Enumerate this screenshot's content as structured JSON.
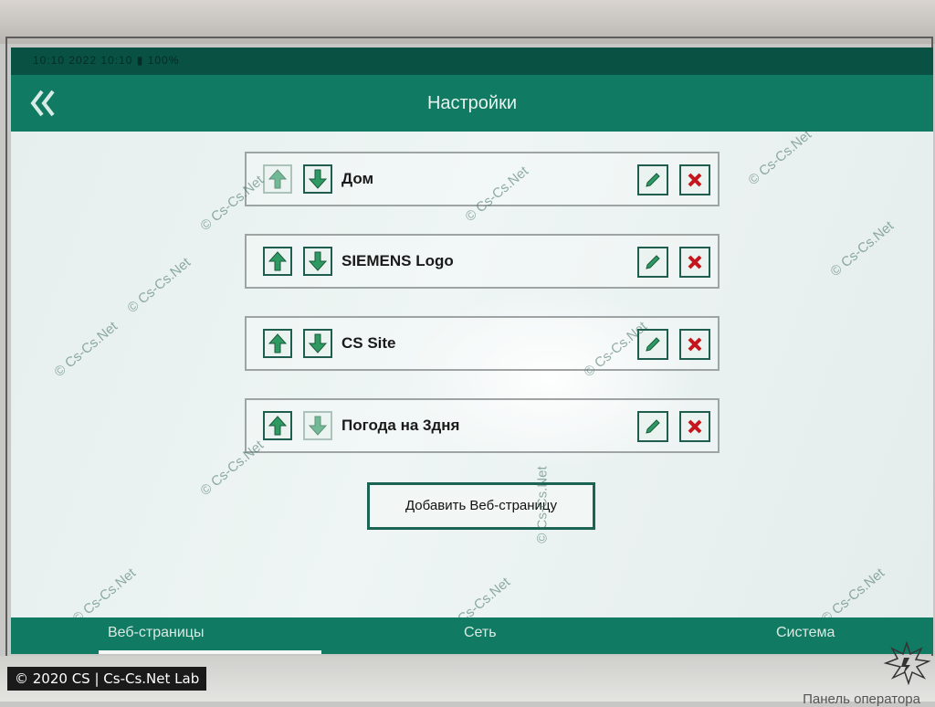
{
  "status": {
    "text": "10:10 2022 10:10 ▮ 100%"
  },
  "header": {
    "title": "Настройки",
    "back_icon": "double-chevron-left-icon"
  },
  "pages": [
    {
      "label": "Дом",
      "up_enabled": false,
      "down_enabled": true
    },
    {
      "label": "SIEMENS Logo",
      "up_enabled": true,
      "down_enabled": true
    },
    {
      "label": "CS Site",
      "up_enabled": true,
      "down_enabled": true
    },
    {
      "label": "Погода на 3дня",
      "up_enabled": true,
      "down_enabled": false
    }
  ],
  "add_button": {
    "label": "Добавить Веб-страницу"
  },
  "tabs": [
    {
      "label": "Веб-страницы",
      "active": true
    },
    {
      "label": "Сеть",
      "active": false
    },
    {
      "label": "Система",
      "active": false
    }
  ],
  "bezel": {
    "caption": "Панель оператора"
  },
  "watermark": {
    "text": "© Cs-Cs.Net"
  },
  "photo_credit": {
    "text": "© 2020 CS | Cs-Cs.Net Lab"
  },
  "colors": {
    "header": "#117a63",
    "accent_green": "#2e9a62",
    "delete_red": "#c4161c",
    "content_bg": "#e6efee"
  }
}
